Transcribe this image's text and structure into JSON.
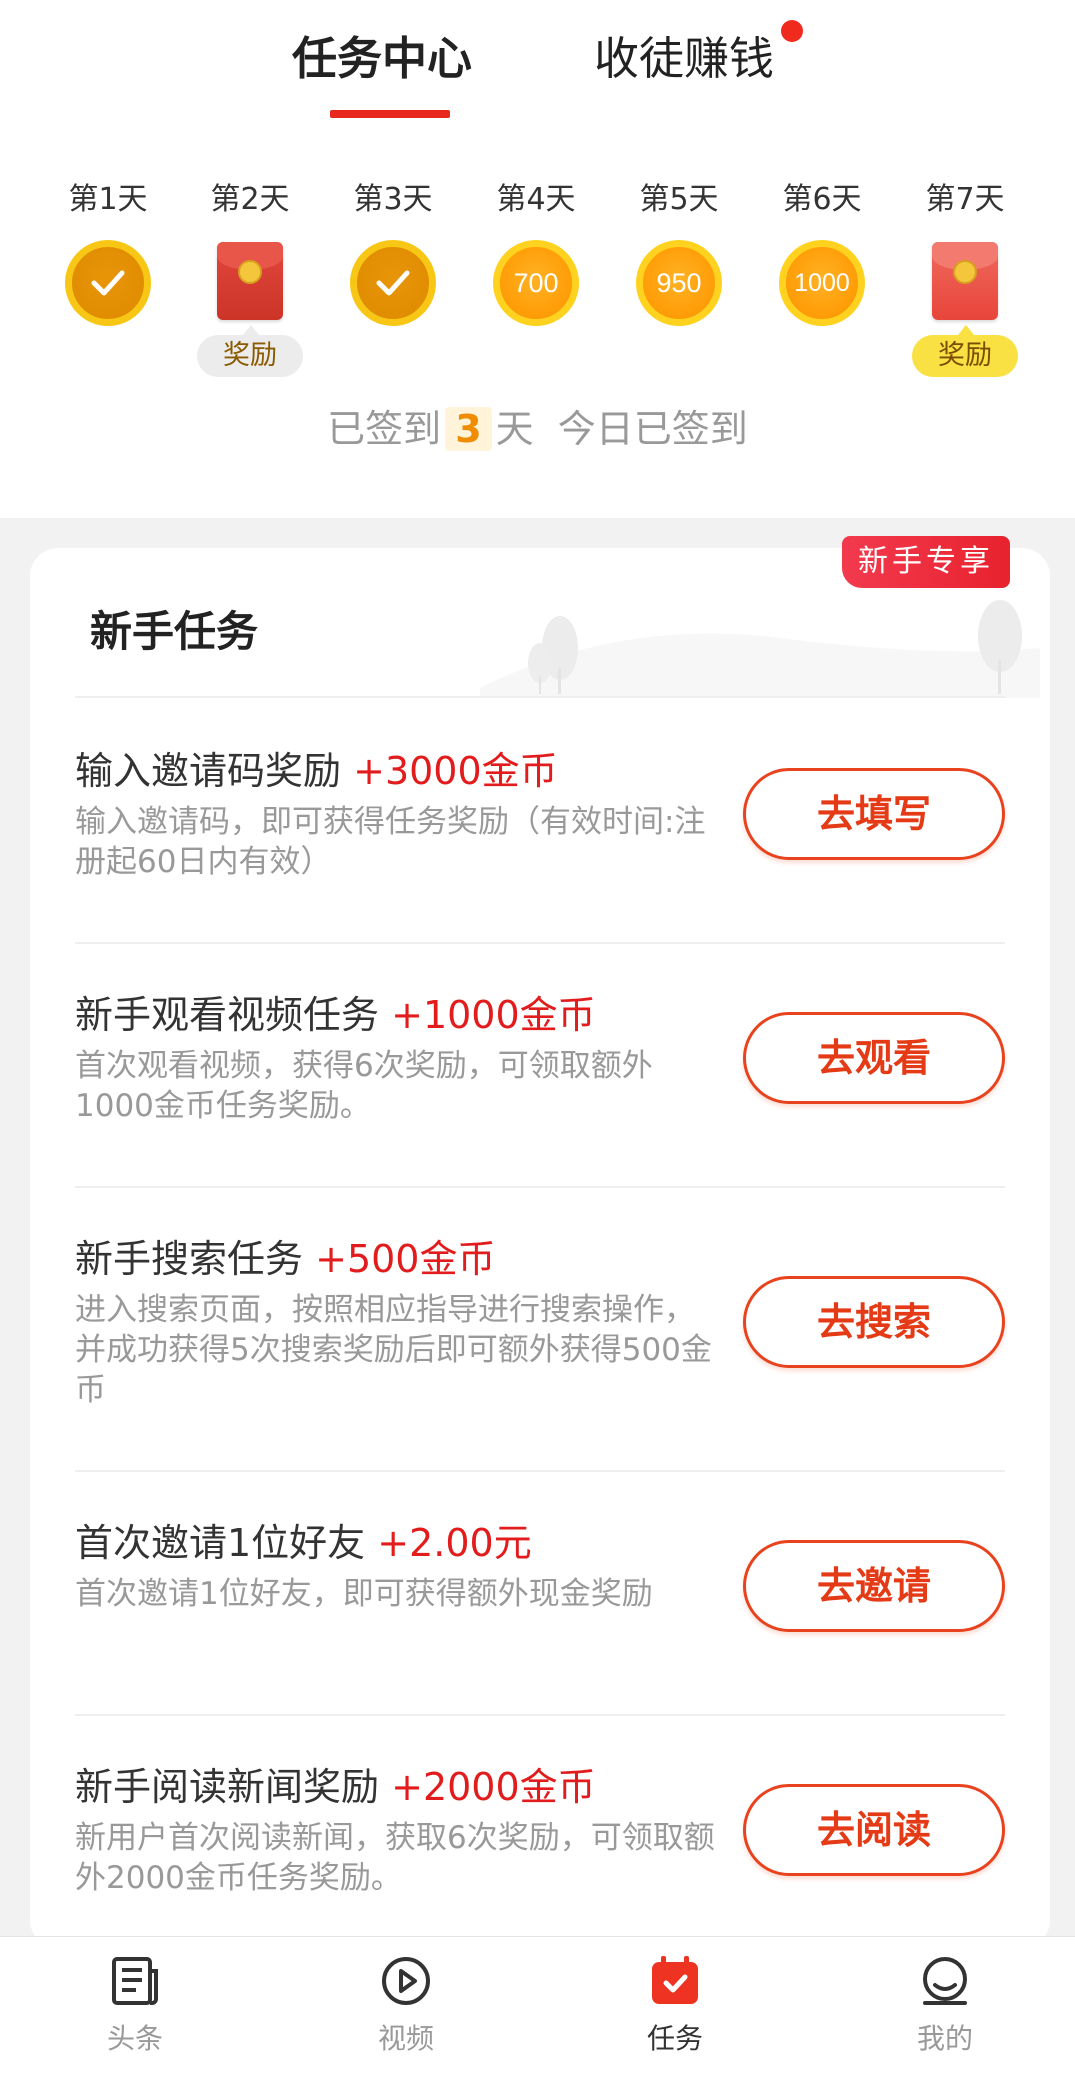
{
  "tabs": {
    "active_label": "任务中心",
    "other_label": "收徒赚钱"
  },
  "checkin": {
    "days": [
      {
        "label": "第1天",
        "state": "checked"
      },
      {
        "label": "第2天",
        "state": "envelope",
        "reward": "奖励"
      },
      {
        "label": "第3天",
        "state": "checked"
      },
      {
        "label": "第4天",
        "state": "coin",
        "value": "700"
      },
      {
        "label": "第5天",
        "state": "coin",
        "value": "950"
      },
      {
        "label": "第6天",
        "state": "coin",
        "value": "1000"
      },
      {
        "label": "第7天",
        "state": "envelope",
        "reward": "奖励"
      }
    ],
    "status_prefix": "已签到",
    "status_count": "3",
    "status_suffix": "天  今日已签到"
  },
  "newbie": {
    "badge": "新手专享",
    "title": "新手任务",
    "tasks": [
      {
        "title": "输入邀请码奖励",
        "reward": "+3000金币",
        "desc": "输入邀请码，即可获得任务奖励（有效时间:注册起60日内有效）",
        "button": "去填写"
      },
      {
        "title": "新手观看视频任务",
        "reward": "+1000金币",
        "desc": "首次观看视频，获得6次奖励，可领取额外1000金币任务奖励。",
        "button": "去观看"
      },
      {
        "title": "新手搜索任务",
        "reward": "+500金币",
        "desc": "进入搜索页面，按照相应指导进行搜索操作，并成功获得5次搜索奖励后即可额外获得500金币",
        "button": "去搜索"
      },
      {
        "title": "首次邀请1位好友",
        "reward": "+2.00元",
        "desc": "首次邀请1位好友，即可获得额外现金奖励",
        "button": "去邀请"
      },
      {
        "title": "新手阅读新闻奖励",
        "reward": "+2000金币",
        "desc": "新用户首次阅读新闻，获取6次奖励，可领取额外2000金币任务奖励。",
        "button": "去阅读"
      }
    ]
  },
  "bottom_nav": {
    "items": [
      {
        "label": "头条",
        "icon": "news-icon"
      },
      {
        "label": "视频",
        "icon": "play-icon"
      },
      {
        "label": "任务",
        "icon": "calendar-check-icon",
        "active": true
      },
      {
        "label": "我的",
        "icon": "user-icon"
      }
    ]
  },
  "colors": {
    "accent_red": "#e8271e",
    "reward_red": "#e21c1c",
    "coin_orange": "#ff9f0a",
    "coin_rim": "#ffd21f"
  }
}
